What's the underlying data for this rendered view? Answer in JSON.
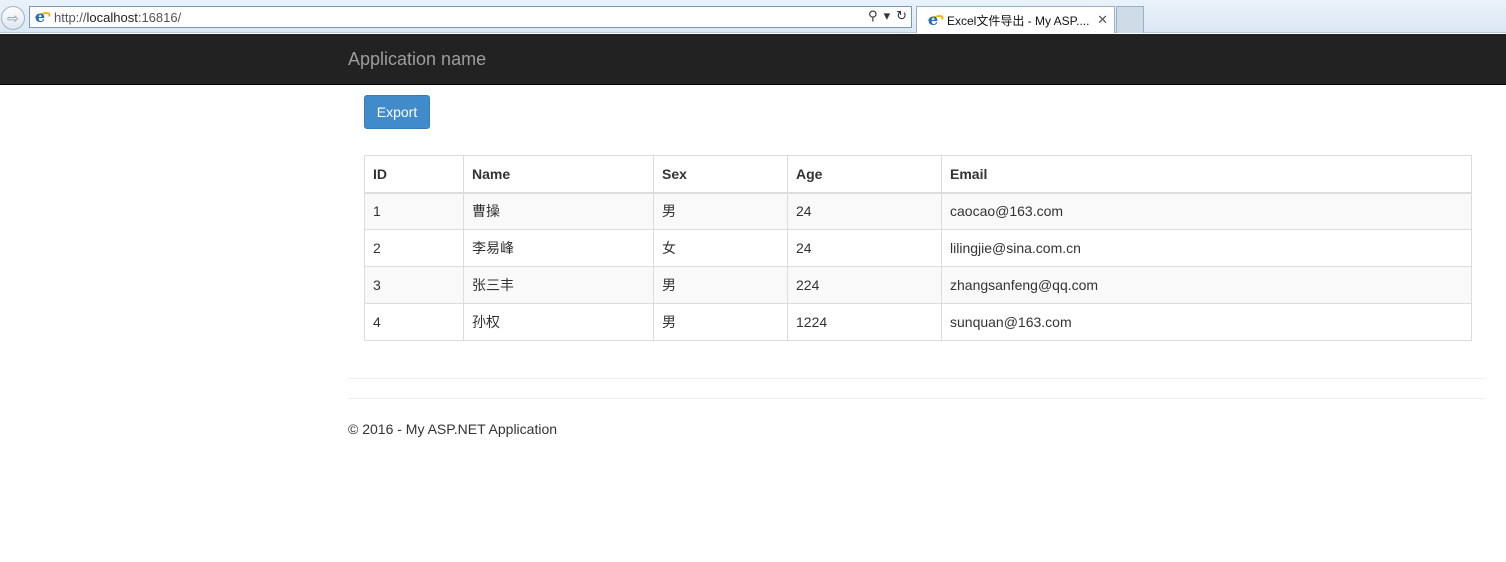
{
  "browser": {
    "url_prefix": "http://",
    "url_host": "localhost",
    "url_rest": ":16816/",
    "tab_title": "Excel文件导出 - My ASP....",
    "search_glyph": "⚲",
    "dropdown_glyph": "▾",
    "refresh_glyph": "↻",
    "close_glyph": "✕",
    "back_glyph": "⇨"
  },
  "navbar": {
    "brand": "Application name"
  },
  "toolbar": {
    "export_label": "Export"
  },
  "table": {
    "headers": [
      "ID",
      "Name",
      "Sex",
      "Age",
      "Email"
    ],
    "rows": [
      [
        "1",
        "曹操",
        "男",
        "24",
        "caocao@163.com"
      ],
      [
        "2",
        "李易峰",
        "女",
        "24",
        "lilingjie@sina.com.cn"
      ],
      [
        "3",
        "张三丰",
        "男",
        "224",
        "zhangsanfeng@qq.com"
      ],
      [
        "4",
        "孙权",
        "男",
        "1224",
        "sunquan@163.com"
      ]
    ]
  },
  "footer": {
    "text": "© 2016 - My ASP.NET Application"
  },
  "colors": {
    "navbar_bg": "#222222",
    "brand_text": "#9d9d9d",
    "primary": "#428bca"
  }
}
